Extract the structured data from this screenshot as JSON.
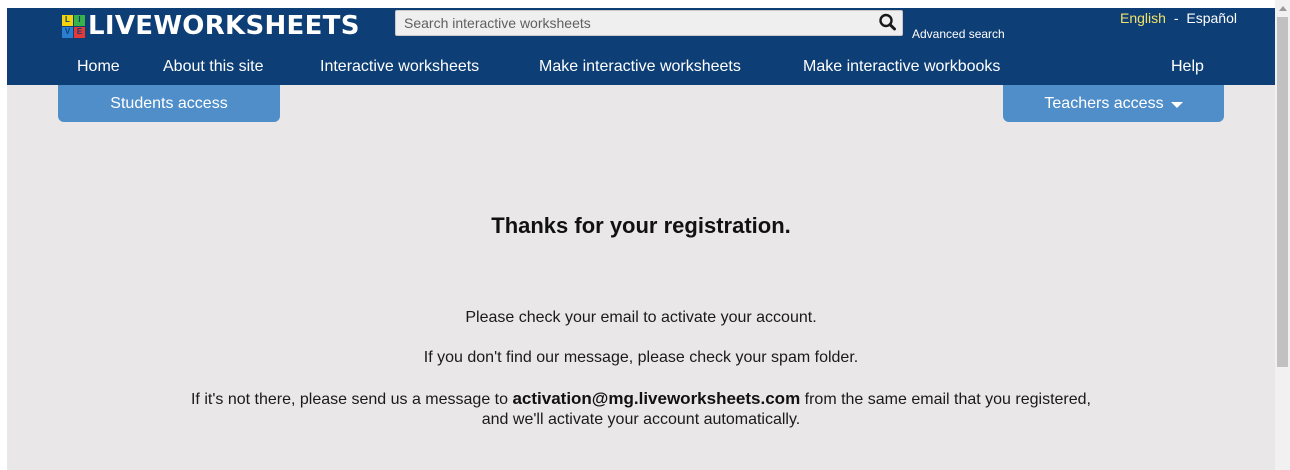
{
  "header": {
    "logo_letters": [
      "L",
      "I",
      "V",
      "E"
    ],
    "logo_colors": [
      "#f5d20a",
      "#37b34a",
      "#2b7fd0",
      "#e53935"
    ],
    "logo_text": "LIVEWORKSHEETS",
    "search_placeholder": "Search interactive worksheets",
    "search_icon": "search-icon",
    "advanced_search": "Advanced search",
    "lang_english": "English",
    "lang_separator": "-",
    "lang_spanish": "Español"
  },
  "nav": {
    "items": [
      {
        "label": "Home"
      },
      {
        "label": "About this site"
      },
      {
        "label": "Interactive worksheets"
      },
      {
        "label": "Make interactive worksheets"
      },
      {
        "label": "Make interactive workbooks"
      },
      {
        "label": "Help"
      }
    ]
  },
  "access": {
    "students": "Students access",
    "teachers": "Teachers access",
    "teachers_icon": "caret-down-icon"
  },
  "content": {
    "title": "Thanks for your registration.",
    "line1": "Please check your email to activate your account.",
    "line2": "If you don't find our message, please check your spam folder.",
    "line3_prefix": "If it's not there, please send us a message to",
    "line3_email": "activation@mg.liveworksheets.com",
    "line3_suffix": "from the same email that you registered,",
    "line4": "and we'll activate your account automatically."
  },
  "colors": {
    "header_bg": "#0d3e75",
    "tab_bg": "#4f8ec9",
    "page_bg": "#e9e7e7",
    "lang_active": "#f2e26b"
  }
}
